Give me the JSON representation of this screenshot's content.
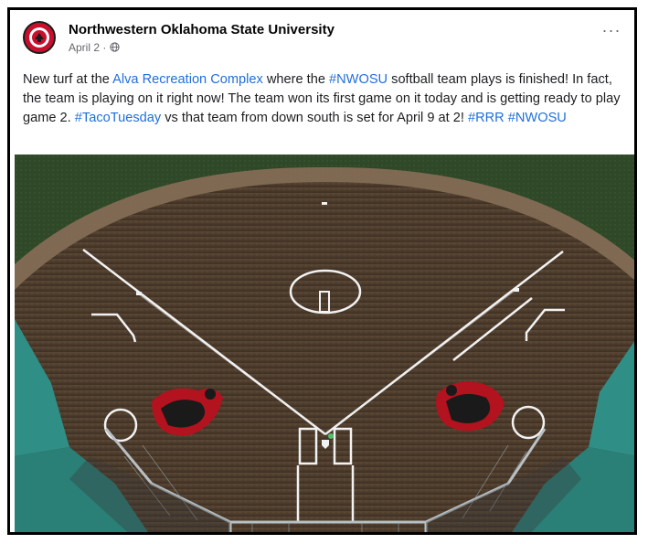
{
  "post": {
    "page_name": "Northwestern Oklahoma State University",
    "date": "April 2",
    "separator": " · ",
    "more_label": "···",
    "text": {
      "part1": "New turf at the ",
      "link1": "Alva Recreation Complex",
      "part2": " where the ",
      "link2": "#NWOSU",
      "part3": " softball team plays is finished! In fact, the team is playing on it right now! The team won its first game on it today and is getting ready to play game 2. ",
      "link3": "#TacoTuesday",
      "part4": " vs that team from down south is set for April 9 at 2! ",
      "link4": "#RRR",
      "part5": " ",
      "link5": "#NWOSU"
    }
  },
  "icons": {
    "avatar": "university-logo-icon",
    "audience": "globe-icon",
    "more": "more-options-icon"
  },
  "colors": {
    "link": "#216fdb",
    "brand_red": "#c8102e",
    "turf": "#4a3a2a",
    "grass": "#2f4a2a",
    "roof": "#2f8f86"
  }
}
